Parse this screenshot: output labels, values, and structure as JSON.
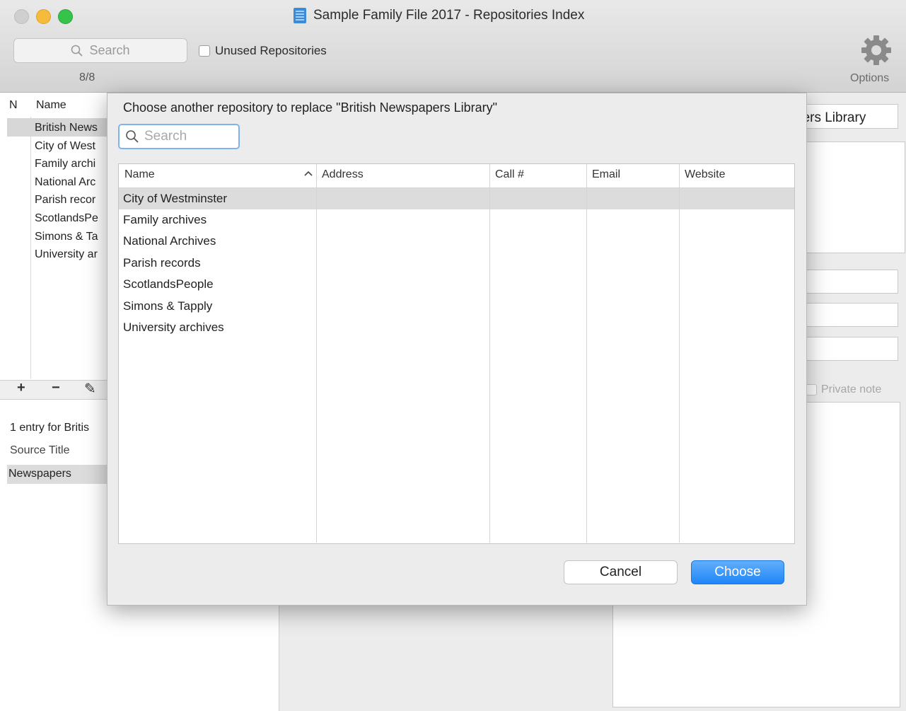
{
  "window": {
    "title": "Sample Family File 2017 - Repositories Index"
  },
  "toolbar": {
    "search_placeholder": "Search",
    "unused_label": "Unused Repositories",
    "count": "8/8",
    "options_label": "Options"
  },
  "left_list": {
    "col_n": "N",
    "col_name": "Name",
    "items": [
      "British News",
      "City of West",
      "Family archi",
      "National Arc",
      "Parish recor",
      "ScotlandsPe",
      "Simons & Ta",
      "University ar"
    ],
    "tools": [
      "+",
      "−",
      "✎"
    ]
  },
  "citations": {
    "entry_text": "1 entry for Britis",
    "source_title_header": "Source Title",
    "source_row": "Newspapers"
  },
  "details": {
    "name_value": "pers Library",
    "private_note_label": "Private note"
  },
  "dialog": {
    "prompt": "Choose another repository to replace \"British Newspapers Library\"",
    "search_placeholder": "Search",
    "columns": [
      "Name",
      "Address",
      "Call #",
      "Email",
      "Website"
    ],
    "rows": [
      "City of Westminster",
      "Family archives",
      "National Archives",
      "Parish records",
      "ScotlandsPeople",
      "Simons & Tapply",
      "University archives"
    ],
    "cancel_label": "Cancel",
    "choose_label": "Choose"
  },
  "icons": [
    "search-icon",
    "gear-icon",
    "document-icon",
    "sort-ascending-icon"
  ],
  "colors": {
    "accent": "#1f86f7",
    "selection": "#dcdcdc"
  }
}
